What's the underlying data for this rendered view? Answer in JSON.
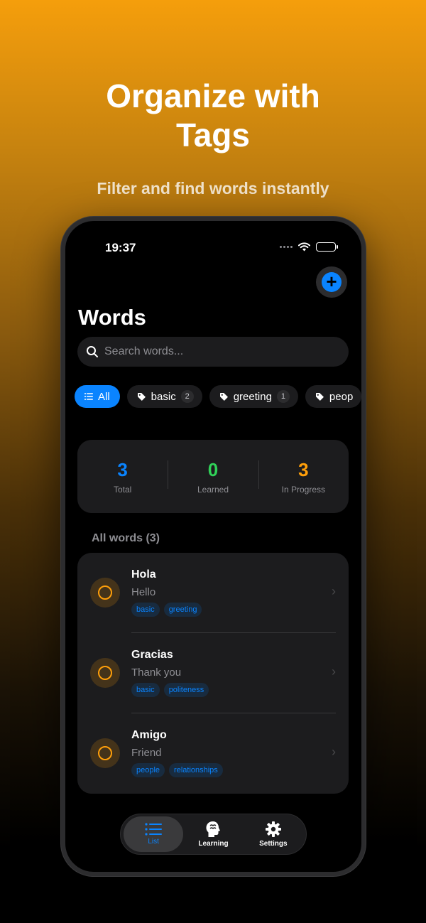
{
  "promo": {
    "headline_line1": "Organize with",
    "headline_line2": "Tags",
    "subtitle": "Filter and find words instantly"
  },
  "status_bar": {
    "time": "19:37"
  },
  "header": {
    "title": "Words",
    "add_button_icon": "plus-icon"
  },
  "search": {
    "placeholder": "Search words..."
  },
  "filters": [
    {
      "label": "All",
      "icon": "list-icon",
      "active": true
    },
    {
      "label": "basic",
      "count": "2",
      "icon": "tag-icon"
    },
    {
      "label": "greeting",
      "count": "1",
      "icon": "tag-icon"
    },
    {
      "label": "peop",
      "icon": "tag-icon"
    }
  ],
  "stats": [
    {
      "value": "3",
      "label": "Total",
      "color": "#0a84ff"
    },
    {
      "value": "0",
      "label": "Learned",
      "color": "#30d158"
    },
    {
      "value": "3",
      "label": "In Progress",
      "color": "#ff9f0a"
    }
  ],
  "section": {
    "label": "All words (3)"
  },
  "words": [
    {
      "word": "Hola",
      "translation": "Hello",
      "tags": [
        "basic",
        "greeting"
      ]
    },
    {
      "word": "Gracias",
      "translation": "Thank you",
      "tags": [
        "basic",
        "politeness"
      ]
    },
    {
      "word": "Amigo",
      "translation": "Friend",
      "tags": [
        "people",
        "relationships"
      ]
    }
  ],
  "tabbar": {
    "tabs": [
      {
        "label": "List",
        "icon": "list-icon",
        "active": true
      },
      {
        "label": "Learning",
        "icon": "brain-head-icon"
      },
      {
        "label": "Settings",
        "icon": "gear-icon"
      }
    ]
  },
  "colors": {
    "accent": "#0a84ff",
    "progress": "#ff9f0a",
    "learned": "#30d158"
  }
}
